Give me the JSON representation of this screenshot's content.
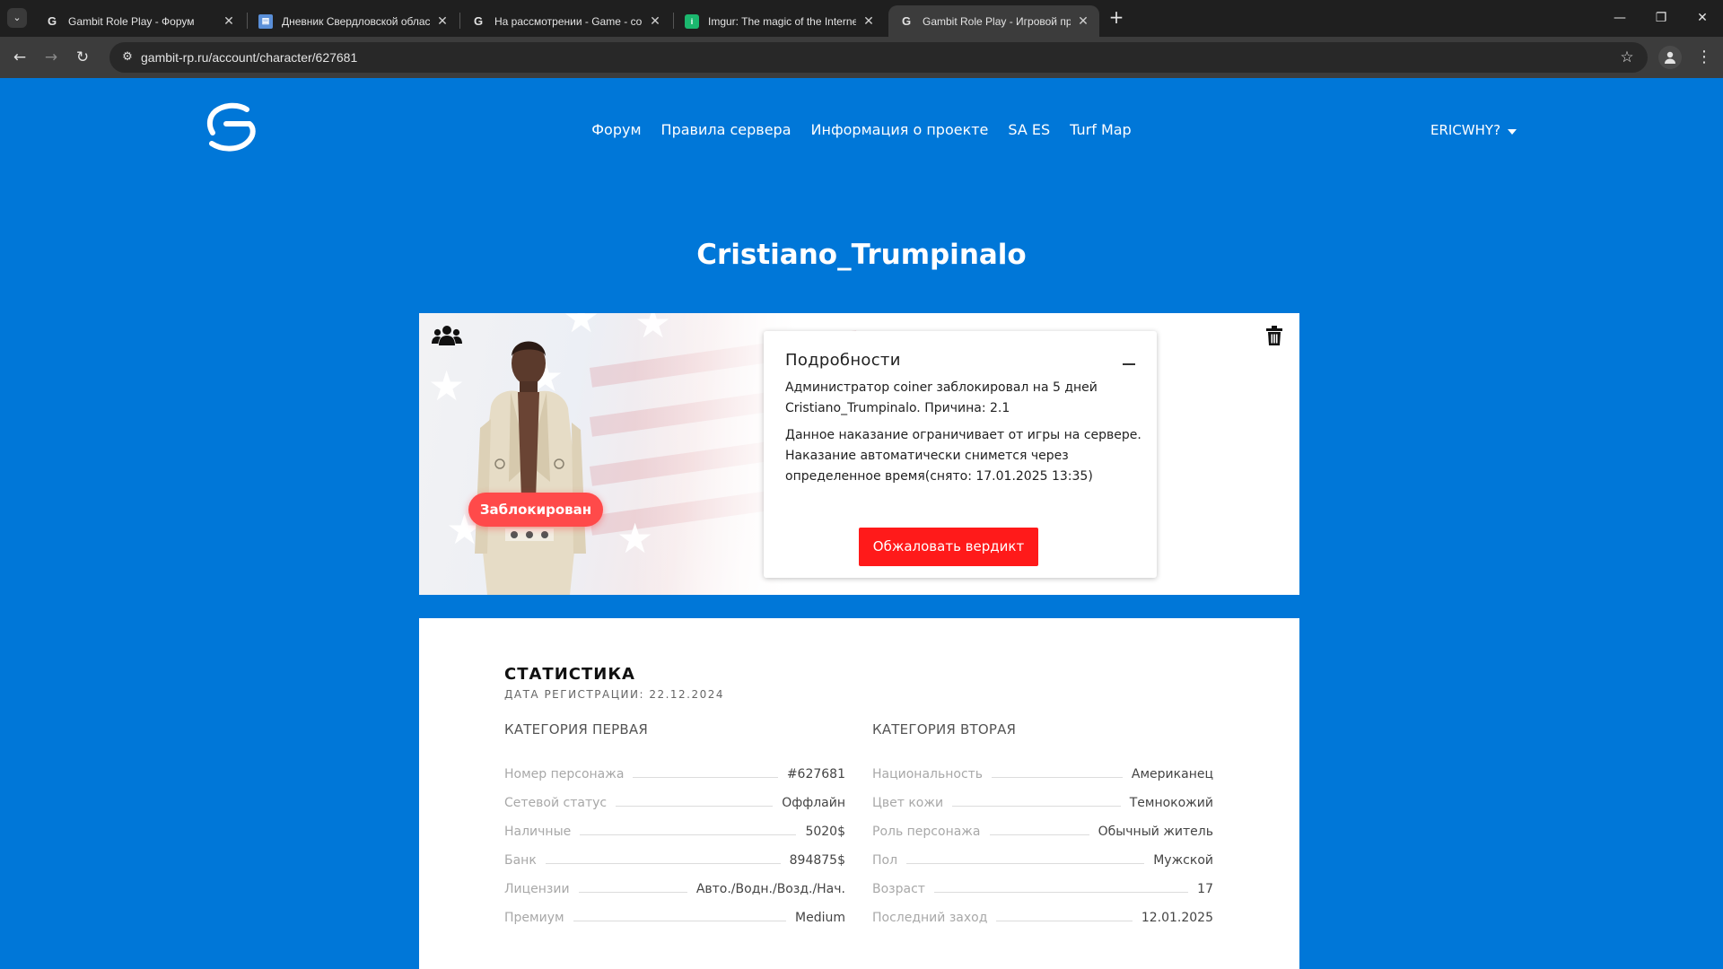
{
  "browser": {
    "tabs": [
      {
        "title": "Gambit Role Play - Форум",
        "icon": "gambit-favicon",
        "active": false
      },
      {
        "title": "Дневник Свердловской облас",
        "icon": "document-favicon",
        "active": false
      },
      {
        "title": "На рассмотрении - Game - co",
        "icon": "gambit-favicon",
        "active": false
      },
      {
        "title": "Imgur: The magic of the Interne",
        "icon": "imgur-favicon",
        "active": false
      },
      {
        "title": "Gambit Role Play - Игровой пр",
        "icon": "gambit-favicon",
        "active": true
      }
    ],
    "url": "gambit-rp.ru/account/character/627681"
  },
  "header": {
    "nav": [
      "Форум",
      "Правила сервера",
      "Информация о проекте",
      "SA ES",
      "Turf Map"
    ],
    "username": "ERICWHY?"
  },
  "character": {
    "name": "Cristiano_Trumpinalo",
    "status_badge": "Заблокирован",
    "details": {
      "title": "Подробности",
      "paragraph1": "Администратор coiner заблокировал на 5 дней Cristiano_Trumpinalo. Причина: 2.1",
      "paragraph2": "Данное наказание ограничивает от игры на сервере. Наказание автоматически снимется через определенное время(снято: 17.01.2025 13:35)",
      "appeal_label": "Обжаловать вердикт"
    }
  },
  "stats": {
    "title": "СТАТИСТИКА",
    "registration": "ДАТА РЕГИСТРАЦИИ: 22.12.2024",
    "category1": {
      "title": "КАТЕГОРИЯ ПЕРВАЯ",
      "rows": [
        {
          "label": "Номер персонажа",
          "value": "#627681"
        },
        {
          "label": "Сетевой статус",
          "value": "Оффлайн"
        },
        {
          "label": "Наличные",
          "value": "5020$"
        },
        {
          "label": "Банк",
          "value": "894875$"
        },
        {
          "label": "Лицензии",
          "value": "Авто./Водн./Возд./Нач."
        },
        {
          "label": "Премиум",
          "value": "Medium"
        }
      ]
    },
    "category2": {
      "title": "КАТЕГОРИЯ ВТОРАЯ",
      "rows": [
        {
          "label": "Национальность",
          "value": "Американец"
        },
        {
          "label": "Цвет кожи",
          "value": "Темнокожий"
        },
        {
          "label": "Роль персонажа",
          "value": "Обычный житель"
        },
        {
          "label": "Пол",
          "value": "Мужской"
        },
        {
          "label": "Возраст",
          "value": "17"
        },
        {
          "label": "Последний заход",
          "value": "12.01.2025"
        }
      ]
    }
  },
  "colors": {
    "page_bg": "#0077d8",
    "danger": "#ff1a1a",
    "badge": "#ff4a4a"
  }
}
